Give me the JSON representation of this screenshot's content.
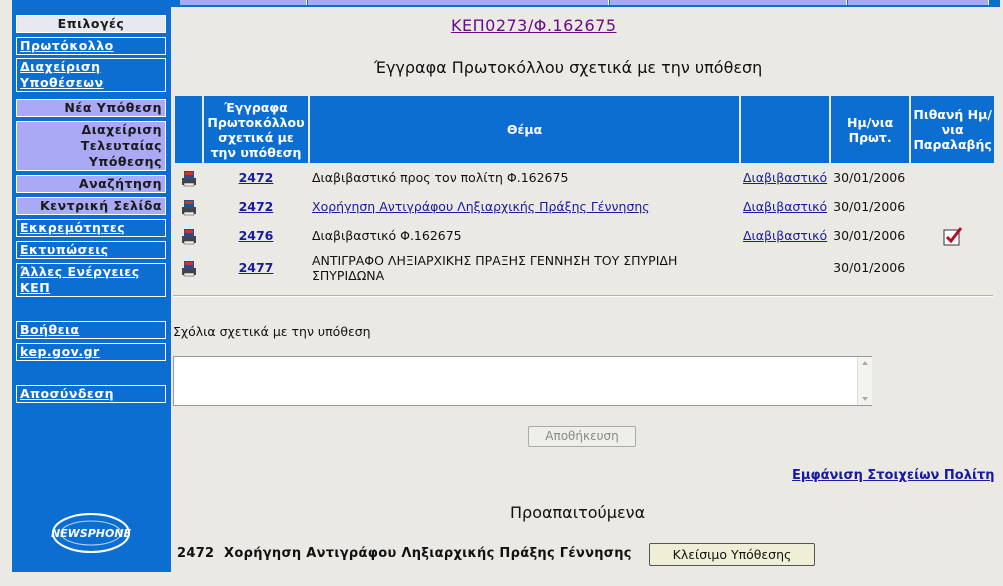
{
  "case_title": "ΚΕΠ0273/Φ.162675",
  "sub_title": "Έγγραφα Πρωτοκόλλου σχετικά με την υπόθεση",
  "sidebar": {
    "options_header": "Επιλογές",
    "items": [
      {
        "label": "Πρωτόκολλο"
      },
      {
        "label": "Διαχείριση Υποθέσεων"
      },
      {
        "label": "Νέα Υπόθεση"
      },
      {
        "label": "Διαχείριση Τελευταίας Υπόθεσης"
      },
      {
        "label": "Αναζήτηση"
      },
      {
        "label": "Κεντρική Σελίδα"
      },
      {
        "label": "Εκκρεμότητες"
      },
      {
        "label": "Εκτυπώσεις"
      },
      {
        "label": "Άλλες Ενέργειες ΚΕΠ"
      },
      {
        "label": "Βοήθεια"
      },
      {
        "label": "kep.gov.gr"
      },
      {
        "label": "Αποσύνδεση"
      }
    ],
    "logo_text": "NEWSPHONE"
  },
  "table": {
    "headers": {
      "docs": "Έγγραφα Πρωτοκόλλου σχετικά με την υπόθεση",
      "subject": "Θέμα",
      "date": "Ημ/νια Πρωτ.",
      "receipt": "Πιθανή Ημ/νια Παραλαβής"
    },
    "rows": [
      {
        "number": "2472",
        "subject": "Διαβιβαστικό προς τον πολίτη Φ.162675",
        "subject_is_link": false,
        "type": "Διαβιβαστικό",
        "date": "30/01/2006",
        "checked": false
      },
      {
        "number": "2472",
        "subject": "Χορήγηση Αντιγράφου Ληξιαρχικής Πράξης Γέννησης",
        "subject_is_link": true,
        "type": "Διαβιβαστικό",
        "date": "30/01/2006",
        "checked": false
      },
      {
        "number": "2476",
        "subject": "Διαβιβαστικό Φ.162675",
        "subject_is_link": false,
        "type": "Διαβιβαστικό",
        "date": "30/01/2006",
        "checked": true
      },
      {
        "number": "2477",
        "subject": "ΑΝΤΙΓΡΑΦΟ ΛΗΞΙΑΡΧΙΚΗΣ ΠΡΑΞΗΣ ΓΕΝΝΗΣΗ ΤΟΥ ΣΠΥΡΙΔΗ ΣΠΥΡΙΔΩΝΑ",
        "subject_is_link": false,
        "type": "",
        "date": "30/01/2006",
        "checked": false
      }
    ]
  },
  "comments": {
    "label": "Σχόλια σχετικά με την υπόθεση",
    "value": ""
  },
  "save_button": "Αποθήκευση",
  "citizen_link": "Εμφάνιση Στοιχείων Πολίτη",
  "prereq": {
    "title": "Προαπαιτούμενα",
    "item_number": "2472",
    "item_text": "Χορήγηση Αντιγράφου Ληξιαρχικής Πράξης Γέννησης"
  },
  "close_button": "Κλείσιμο Υπόθεσης",
  "colors": {
    "sidebar": "#0b6ed0",
    "lavender": "#a9a9f5",
    "link": "#1a1aa0",
    "title": "#6a0a8a"
  }
}
